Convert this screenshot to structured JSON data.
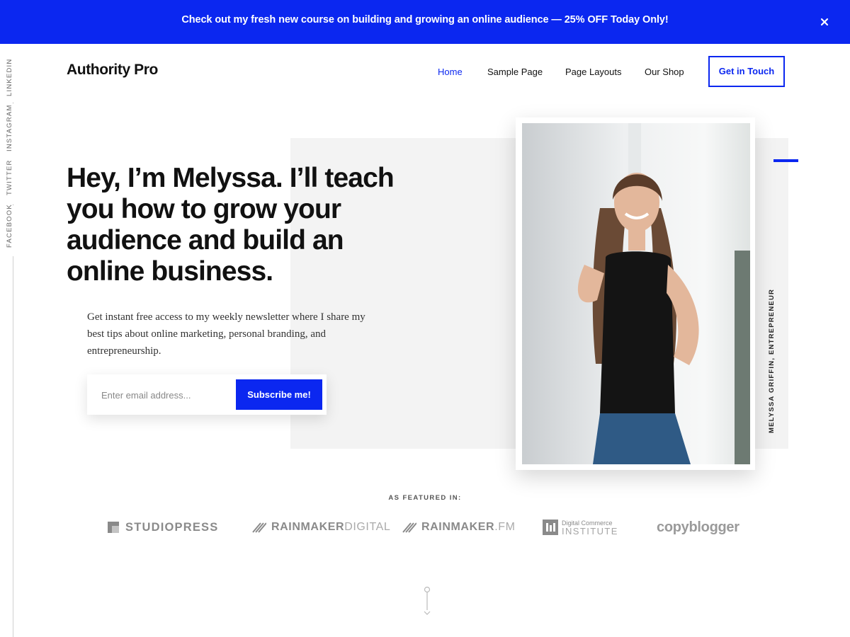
{
  "announcement": {
    "text": "Check out my fresh new course on building and growing an online audience — 25% OFF Today Only!",
    "close_icon": "close-icon"
  },
  "social": {
    "items": [
      "FACEBOOK",
      "TWITTER",
      "INSTAGRAM",
      "LINKEDIN"
    ],
    "separator": "·"
  },
  "header": {
    "brand": "Authority Pro",
    "nav": [
      "Home",
      "Sample Page",
      "Page Layouts",
      "Our Shop"
    ],
    "active_nav": "Home",
    "cta_label": "Get in Touch"
  },
  "hero": {
    "headline": "Hey, I’m Melyssa. I’ll teach you how to grow your audience and build an online business.",
    "intro": "Get instant free access to my weekly newsletter where I share my best tips about online marketing, personal branding, and entrepreneurship.",
    "email_placeholder": "Enter email address...",
    "subscribe_label": "Subscribe me!",
    "photo_caption": "MELYSSA GRIFFIN, ENTREPRENEUR"
  },
  "featured": {
    "label": "AS FEATURED IN:",
    "logos": {
      "studiopress": "STUDIOPRESS",
      "rainmaker_digital": {
        "a": "RAINMAKER",
        "b": "DIGITAL"
      },
      "rainmaker_fm": {
        "a": "RAINMAKER",
        "b": ".FM"
      },
      "dci": {
        "line1": "Digital Commerce",
        "line2": "INSTITUTE"
      },
      "copyblogger": "copyblogger"
    }
  },
  "colors": {
    "accent": "#0b27f0",
    "hero_panel": "#f3f3f3",
    "text": "#111111"
  }
}
